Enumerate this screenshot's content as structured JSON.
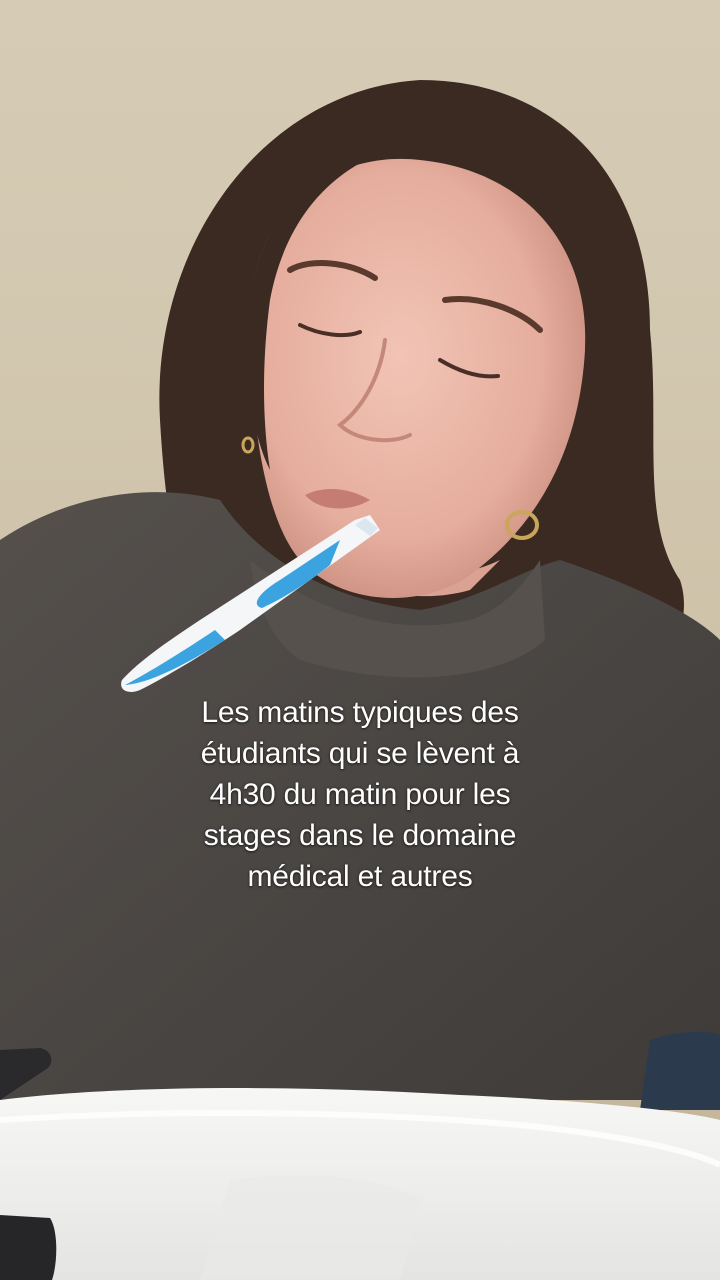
{
  "overlay": {
    "caption_lines": [
      "Les matins typiques des",
      "étudiants qui se lèvent à",
      "4h30 du matin pour les",
      "stages dans le domaine",
      "médical et autres"
    ],
    "text_color": "#ffffff"
  },
  "scene": {
    "colors": {
      "wall": "#d2c6ad",
      "hair": "#3a2a22",
      "hair_tips": "#a8643a",
      "skin": "#e8b7a8",
      "sweater": "#4e4a47",
      "toothbrush_blue": "#3aa3e0",
      "sink": "#f2f2f0",
      "radiator": "#e6e3dc",
      "cloth": "#24304f"
    }
  }
}
